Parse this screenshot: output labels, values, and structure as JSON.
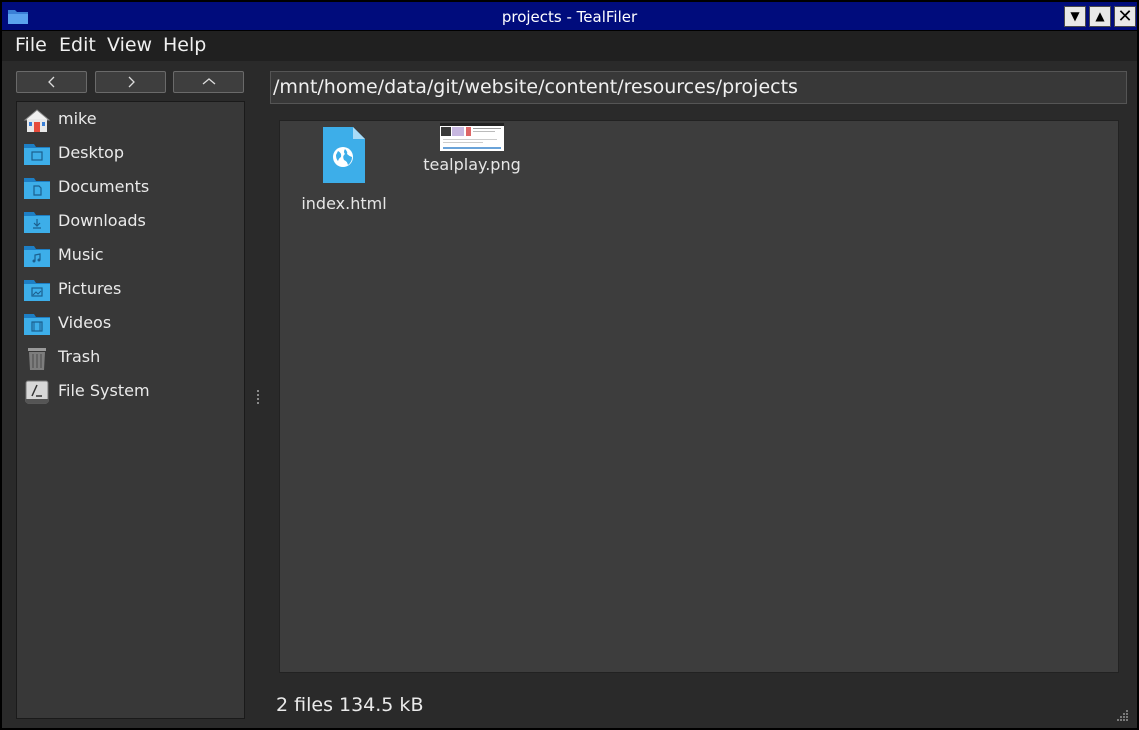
{
  "window": {
    "title": "projects - TealFiler",
    "controls": {
      "minimize": "▼",
      "maximize": "▲",
      "close": "✕"
    }
  },
  "menubar": {
    "items": [
      {
        "label": "File"
      },
      {
        "label": "Edit"
      },
      {
        "label": "View"
      },
      {
        "label": "Help"
      }
    ]
  },
  "nav": {
    "back_icon": "chevron-left-icon",
    "forward_icon": "chevron-right-icon",
    "up_icon": "chevron-up-icon"
  },
  "sidebar": {
    "items": [
      {
        "label": "mike",
        "icon": "home-icon"
      },
      {
        "label": "Desktop",
        "icon": "folder-desktop-icon"
      },
      {
        "label": "Documents",
        "icon": "folder-documents-icon"
      },
      {
        "label": "Downloads",
        "icon": "folder-downloads-icon"
      },
      {
        "label": "Music",
        "icon": "folder-music-icon"
      },
      {
        "label": "Pictures",
        "icon": "folder-pictures-icon"
      },
      {
        "label": "Videos",
        "icon": "folder-videos-icon"
      },
      {
        "label": "Trash",
        "icon": "trash-icon"
      },
      {
        "label": "File System",
        "icon": "drive-icon"
      }
    ]
  },
  "location": {
    "path": "/mnt/home/data/git/website/content/resources/projects"
  },
  "files": [
    {
      "name": "index.html",
      "icon": "html-file-icon"
    },
    {
      "name": "tealplay.png",
      "icon": "image-thumbnail"
    }
  ],
  "status": {
    "text": "2 files 134.5 kB"
  },
  "colors": {
    "titlebar": "#000c7c",
    "folder_blue": "#3daee9",
    "background": "#2a2a2a",
    "pane": "#3d3d3d"
  }
}
